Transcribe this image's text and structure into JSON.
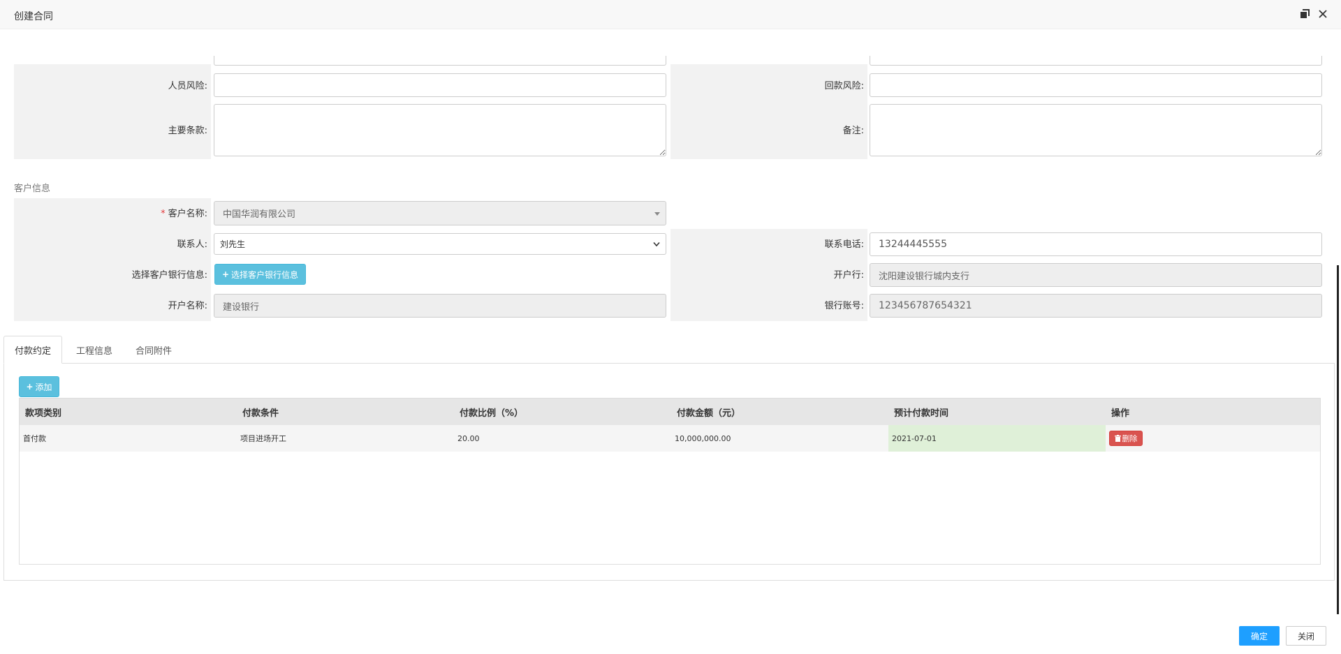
{
  "window": {
    "title": "创建合同"
  },
  "form_top": {
    "personnel_risk_label": "人员风险:",
    "payment_risk_label": "回款风险:",
    "main_terms_label": "主要条款:",
    "remark_label": "备注:"
  },
  "customer": {
    "section_title": "客户信息",
    "required_mark": "*",
    "name_label": "客户名称:",
    "name_value": "中国华润有限公司",
    "contact_label": "联系人:",
    "contact_value": "刘先生",
    "phone_label": "联系电话:",
    "phone_value": "13244445555",
    "bank_select_label": "选择客户银行信息:",
    "bank_select_button": "选择客户银行信息",
    "bank_branch_label": "开户行:",
    "bank_branch_value": "沈阳建设银行城内支行",
    "account_name_label": "开户名称:",
    "account_name_value": "建设银行",
    "account_number_label": "银行账号:",
    "account_number_value": "123456787654321"
  },
  "tabs": [
    {
      "label": "付款约定",
      "active": true
    },
    {
      "label": "工程信息",
      "active": false
    },
    {
      "label": "合同附件",
      "active": false
    }
  ],
  "payment": {
    "add_button": "添加",
    "columns": [
      "款项类别",
      "付款条件",
      "付款比例（%）",
      "付款金额（元）",
      "预计付款时间",
      "操作"
    ],
    "rows": [
      {
        "type": "首付款",
        "condition": "项目进场开工",
        "ratio": "20.00",
        "amount": "10,000,000.00",
        "date": "2021-07-01",
        "action": "删除"
      }
    ]
  },
  "footer": {
    "confirm": "确定",
    "close": "关闭"
  }
}
